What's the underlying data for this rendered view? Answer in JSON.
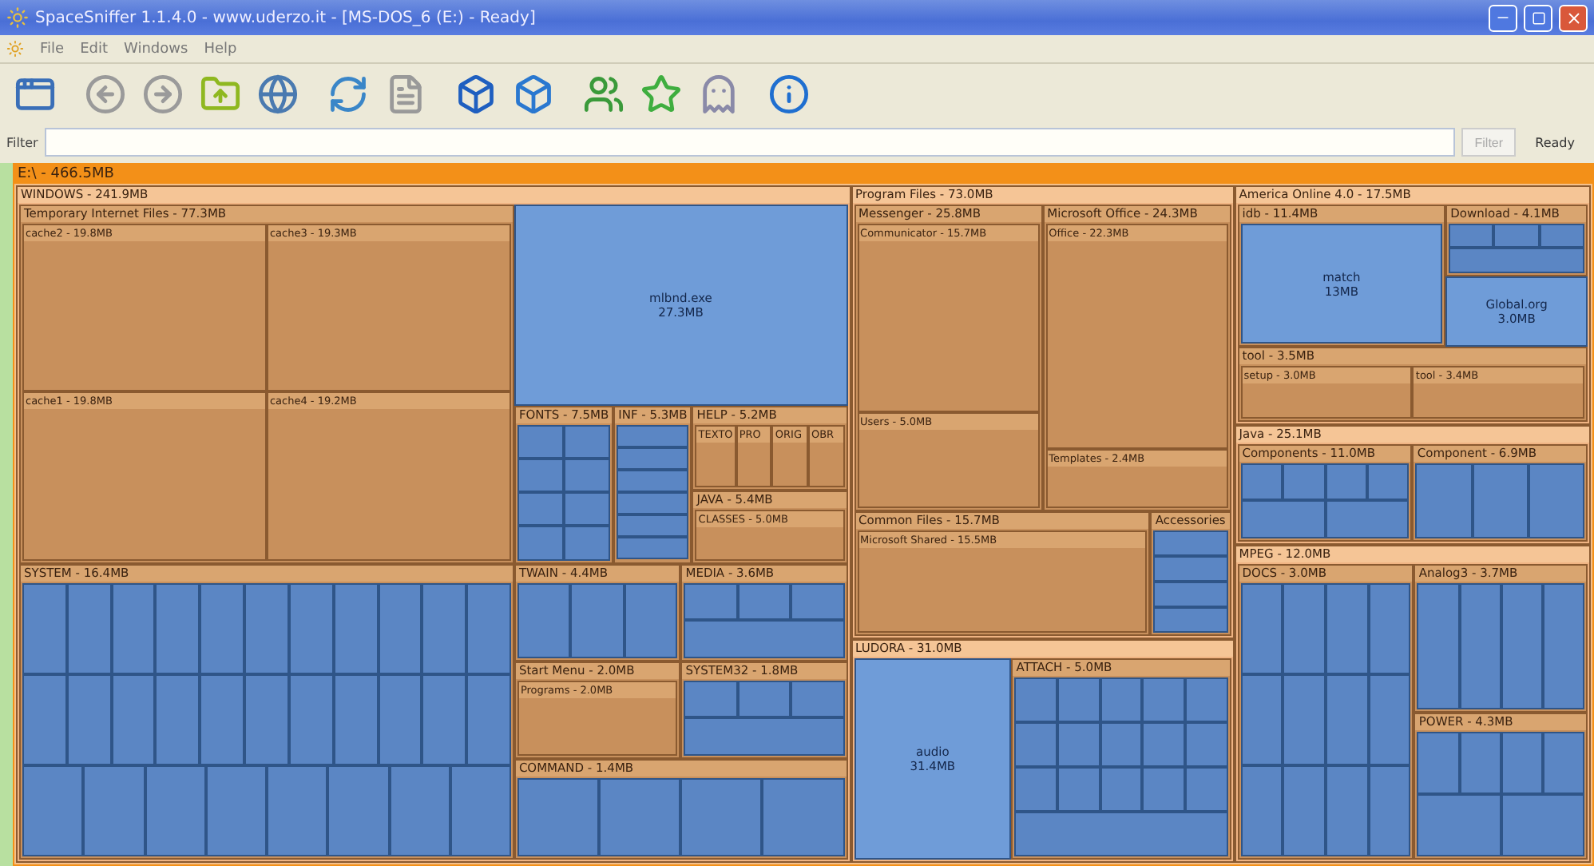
{
  "window": {
    "title": "SpaceSniffer 1.1.4.0 - www.uderzo.it - [MS-DOS_6 (E:) - Ready]"
  },
  "menu": [
    "File",
    "Edit",
    "Windows",
    "Help"
  ],
  "filter": {
    "label": "Filter",
    "button": "Filter",
    "status": "Ready"
  },
  "treemap": {
    "kind": "folder",
    "label": "E:\\ - 466.5MB",
    "children": [
      {
        "kind": "folder",
        "label": "WINDOWS - 241.9MB",
        "children": [
          {
            "kind": "folder",
            "label": "Temporary Internet Files - 77.3MB",
            "children": [
              {
                "kind": "folder",
                "label": "cache2 - 19.8MB"
              },
              {
                "kind": "folder",
                "label": "cache3 - 19.3MB"
              },
              {
                "kind": "folder",
                "label": "cache1 - 19.8MB"
              },
              {
                "kind": "folder",
                "label": "cache4 - 19.2MB"
              }
            ]
          },
          {
            "kind": "file",
            "label": "mlbnd.exe",
            "size": "27.3MB"
          },
          {
            "kind": "folder",
            "label": "FONTS - 7.5MB",
            "children": [
              {
                "kind": "file"
              },
              {
                "kind": "file"
              },
              {
                "kind": "file"
              },
              {
                "kind": "file"
              },
              {
                "kind": "file"
              },
              {
                "kind": "file"
              },
              {
                "kind": "file"
              },
              {
                "kind": "file"
              }
            ]
          },
          {
            "kind": "folder",
            "label": "INF - 5.3MB",
            "children": [
              {
                "kind": "file"
              },
              {
                "kind": "file"
              },
              {
                "kind": "file"
              },
              {
                "kind": "file"
              },
              {
                "kind": "file"
              },
              {
                "kind": "file"
              }
            ]
          },
          {
            "kind": "folder",
            "label": "HELP - 5.2MB",
            "children": [
              {
                "kind": "folder",
                "label": "TEXTO"
              },
              {
                "kind": "folder",
                "label": "PRO"
              },
              {
                "kind": "folder",
                "label": "ORIG"
              },
              {
                "kind": "folder",
                "label": "OBR"
              }
            ]
          },
          {
            "kind": "folder",
            "label": "JAVA - 5.4MB",
            "children": [
              {
                "kind": "folder",
                "label": "CLASSES - 5.0MB"
              }
            ]
          },
          {
            "kind": "folder",
            "label": "SYSTEM - 16.4MB",
            "children": [
              {
                "kind": "file"
              },
              {
                "kind": "file"
              },
              {
                "kind": "file"
              },
              {
                "kind": "file"
              },
              {
                "kind": "file"
              },
              {
                "kind": "file"
              },
              {
                "kind": "file"
              },
              {
                "kind": "file"
              },
              {
                "kind": "file"
              },
              {
                "kind": "file"
              },
              {
                "kind": "file"
              },
              {
                "kind": "file"
              },
              {
                "kind": "file"
              },
              {
                "kind": "file"
              },
              {
                "kind": "file"
              },
              {
                "kind": "file"
              },
              {
                "kind": "file"
              },
              {
                "kind": "file"
              },
              {
                "kind": "file"
              },
              {
                "kind": "file"
              },
              {
                "kind": "file"
              },
              {
                "kind": "file"
              },
              {
                "kind": "file"
              },
              {
                "kind": "file"
              },
              {
                "kind": "file"
              },
              {
                "kind": "file"
              },
              {
                "kind": "file"
              },
              {
                "kind": "file"
              },
              {
                "kind": "file"
              },
              {
                "kind": "file"
              }
            ]
          },
          {
            "kind": "folder",
            "label": "TWAIN - 4.4MB",
            "children": [
              {
                "kind": "file"
              },
              {
                "kind": "file"
              },
              {
                "kind": "file"
              }
            ]
          },
          {
            "kind": "folder",
            "label": "MEDIA - 3.6MB",
            "children": [
              {
                "kind": "file"
              },
              {
                "kind": "file"
              },
              {
                "kind": "file"
              },
              {
                "kind": "file"
              }
            ]
          },
          {
            "kind": "folder",
            "label": "Start Menu - 2.0MB",
            "children": [
              {
                "kind": "folder",
                "label": "Programs - 2.0MB"
              }
            ]
          },
          {
            "kind": "folder",
            "label": "SYSTEM32 - 1.8MB",
            "children": [
              {
                "kind": "file"
              },
              {
                "kind": "file"
              },
              {
                "kind": "file"
              },
              {
                "kind": "file"
              }
            ]
          },
          {
            "kind": "folder",
            "label": "COMMAND - 1.4MB",
            "children": [
              {
                "kind": "file"
              },
              {
                "kind": "file"
              },
              {
                "kind": "file"
              },
              {
                "kind": "file"
              }
            ]
          }
        ]
      },
      {
        "kind": "folder",
        "label": "Program Files - 73.0MB",
        "children": [
          {
            "kind": "folder",
            "label": "Messenger - 25.8MB",
            "children": [
              {
                "kind": "folder",
                "label": "Communicator - 15.7MB"
              },
              {
                "kind": "folder",
                "label": "Users - 5.0MB"
              }
            ]
          },
          {
            "kind": "folder",
            "label": "Microsoft Office - 24.3MB",
            "children": [
              {
                "kind": "folder",
                "label": "Office - 22.3MB"
              },
              {
                "kind": "folder",
                "label": "Templates - 2.4MB"
              }
            ]
          },
          {
            "kind": "folder",
            "label": "Common Files - 15.7MB",
            "children": [
              {
                "kind": "folder",
                "label": "Microsoft Shared - 15.5MB"
              }
            ]
          },
          {
            "kind": "folder",
            "label": "Accessories",
            "children": [
              {
                "kind": "file"
              },
              {
                "kind": "file"
              },
              {
                "kind": "file"
              },
              {
                "kind": "file"
              }
            ]
          }
        ]
      },
      {
        "kind": "folder",
        "label": "LUDORA - 31.0MB",
        "children": [
          {
            "kind": "file",
            "label": "audio",
            "size": "31.4MB"
          },
          {
            "kind": "folder",
            "label": "ATTACH - 5.0MB",
            "children": [
              {
                "kind": "file"
              },
              {
                "kind": "file"
              },
              {
                "kind": "file"
              },
              {
                "kind": "file"
              },
              {
                "kind": "file"
              },
              {
                "kind": "file"
              },
              {
                "kind": "file"
              },
              {
                "kind": "file"
              },
              {
                "kind": "file"
              },
              {
                "kind": "file"
              },
              {
                "kind": "file"
              },
              {
                "kind": "file"
              },
              {
                "kind": "file"
              },
              {
                "kind": "file"
              },
              {
                "kind": "file"
              },
              {
                "kind": "file"
              }
            ]
          }
        ]
      },
      {
        "kind": "folder",
        "label": "America Online 4.0 - 17.5MB",
        "children": [
          {
            "kind": "folder",
            "label": "idb - 11.4MB",
            "children": [
              {
                "kind": "file",
                "label": "match",
                "size": "13MB"
              }
            ]
          },
          {
            "kind": "folder",
            "label": "tool - 3.5MB",
            "children": [
              {
                "kind": "folder",
                "label": "setup - 3.0MB"
              },
              {
                "kind": "folder",
                "label": "tool - 3.4MB"
              }
            ]
          },
          {
            "kind": "folder",
            "label": "Download - 4.1MB",
            "children": [
              {
                "kind": "file"
              },
              {
                "kind": "file"
              },
              {
                "kind": "file"
              },
              {
                "kind": "file"
              }
            ]
          },
          {
            "kind": "file",
            "label": "Global.org",
            "size": "3.0MB"
          }
        ]
      },
      {
        "kind": "folder",
        "label": "Java - 25.1MB",
        "children": [
          {
            "kind": "folder",
            "label": "Components - 11.0MB",
            "children": [
              {
                "kind": "file"
              },
              {
                "kind": "file"
              },
              {
                "kind": "file"
              },
              {
                "kind": "file"
              },
              {
                "kind": "file"
              },
              {
                "kind": "file"
              }
            ]
          },
          {
            "kind": "folder",
            "label": "Component - 6.9MB",
            "children": [
              {
                "kind": "file"
              },
              {
                "kind": "file"
              },
              {
                "kind": "file"
              }
            ]
          }
        ]
      },
      {
        "kind": "folder",
        "label": "MPEG - 12.0MB",
        "children": [
          {
            "kind": "folder",
            "label": "DOCS - 3.0MB",
            "children": [
              {
                "kind": "file"
              },
              {
                "kind": "file"
              },
              {
                "kind": "file"
              },
              {
                "kind": "file"
              },
              {
                "kind": "file"
              },
              {
                "kind": "file"
              },
              {
                "kind": "file"
              },
              {
                "kind": "file"
              },
              {
                "kind": "file"
              },
              {
                "kind": "file"
              },
              {
                "kind": "file"
              },
              {
                "kind": "file"
              }
            ]
          },
          {
            "kind": "folder",
            "label": "Analog3 - 3.7MB",
            "children": [
              {
                "kind": "file"
              },
              {
                "kind": "file"
              },
              {
                "kind": "file"
              },
              {
                "kind": "file"
              }
            ]
          },
          {
            "kind": "folder",
            "label": "POWER - 4.3MB",
            "children": [
              {
                "kind": "file"
              },
              {
                "kind": "file"
              },
              {
                "kind": "file"
              },
              {
                "kind": "file"
              },
              {
                "kind": "file"
              },
              {
                "kind": "file"
              }
            ]
          }
        ]
      }
    ]
  }
}
